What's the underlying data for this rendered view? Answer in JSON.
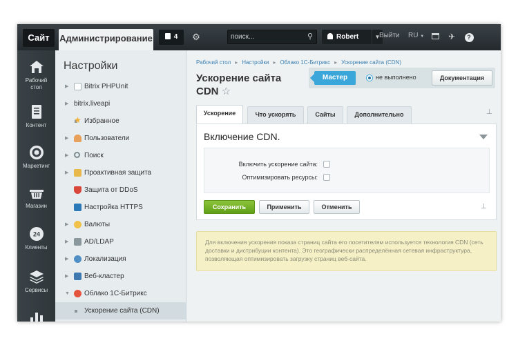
{
  "topbar": {
    "site_tab": "Сайт",
    "admin_tab": "Администрирование",
    "notifications_count": "4",
    "search_placeholder": "поиск...",
    "user_name": "Robert",
    "logout_label": "Выйти",
    "language": "RU"
  },
  "icon_column": [
    {
      "label": "Рабочий стол",
      "icon": "home-icon"
    },
    {
      "label": "Контент",
      "icon": "document-icon"
    },
    {
      "label": "Маркетинг",
      "icon": "target-icon"
    },
    {
      "label": "Магазин",
      "icon": "basket-icon"
    },
    {
      "label": "Клиенты",
      "icon": "clock-24-icon"
    },
    {
      "label": "Сервисы",
      "icon": "layers-icon"
    }
  ],
  "nav": {
    "title": "Настройки",
    "items": [
      {
        "label": "Bitrix PHPUnit",
        "icon": "page-icon"
      },
      {
        "label": "bitrix.liveapi",
        "icon": ""
      },
      {
        "label": "Избранное",
        "icon": "star-icon"
      },
      {
        "label": "Пользователи",
        "icon": "user-icon"
      },
      {
        "label": "Поиск",
        "icon": "magnifier-icon"
      },
      {
        "label": "Проактивная защита",
        "icon": "lock-icon"
      },
      {
        "label": "Защита от DDoS",
        "icon": "shield-icon"
      },
      {
        "label": "Настройка HTTPS",
        "icon": "https-icon"
      },
      {
        "label": "Валюты",
        "icon": "coin-icon"
      },
      {
        "label": "AD/LDAP",
        "icon": "server-icon"
      },
      {
        "label": "Локализация",
        "icon": "globe-icon"
      },
      {
        "label": "Веб-кластер",
        "icon": "cluster-icon"
      },
      {
        "label": "Облако 1С-Битрикс",
        "icon": "cloud-icon"
      },
      {
        "label": "Ускорение сайта (CDN)",
        "icon": ""
      }
    ]
  },
  "breadcrumbs": [
    "Рабочий стол",
    "Настройки",
    "Облако 1С-Битрикс",
    "Ускорение сайта (CDN)"
  ],
  "page": {
    "title": "Ускорение сайта CDN",
    "master_label": "Мастер",
    "status_text": "не выполнено",
    "docs_label": "Документация"
  },
  "tabs": [
    "Ускорение",
    "Что ускорять",
    "Сайты",
    "Дополнительно"
  ],
  "panel": {
    "title": "Включение CDN.",
    "fields": [
      {
        "label": "Включить ускорение сайта:",
        "checked": false
      },
      {
        "label": "Оптимизировать ресурсы:",
        "checked": false
      }
    ],
    "buttons": {
      "save": "Сохранить",
      "apply": "Применить",
      "cancel": "Отменить"
    }
  },
  "info": "Для включения ускорения показа страниц сайта его посетителям используется технология CDN (сеть доставки и дистрибуции контента). Это географически распределённая сетевая инфраструктура, позволяющая оптимизировать загрузку страниц веб-сайта."
}
